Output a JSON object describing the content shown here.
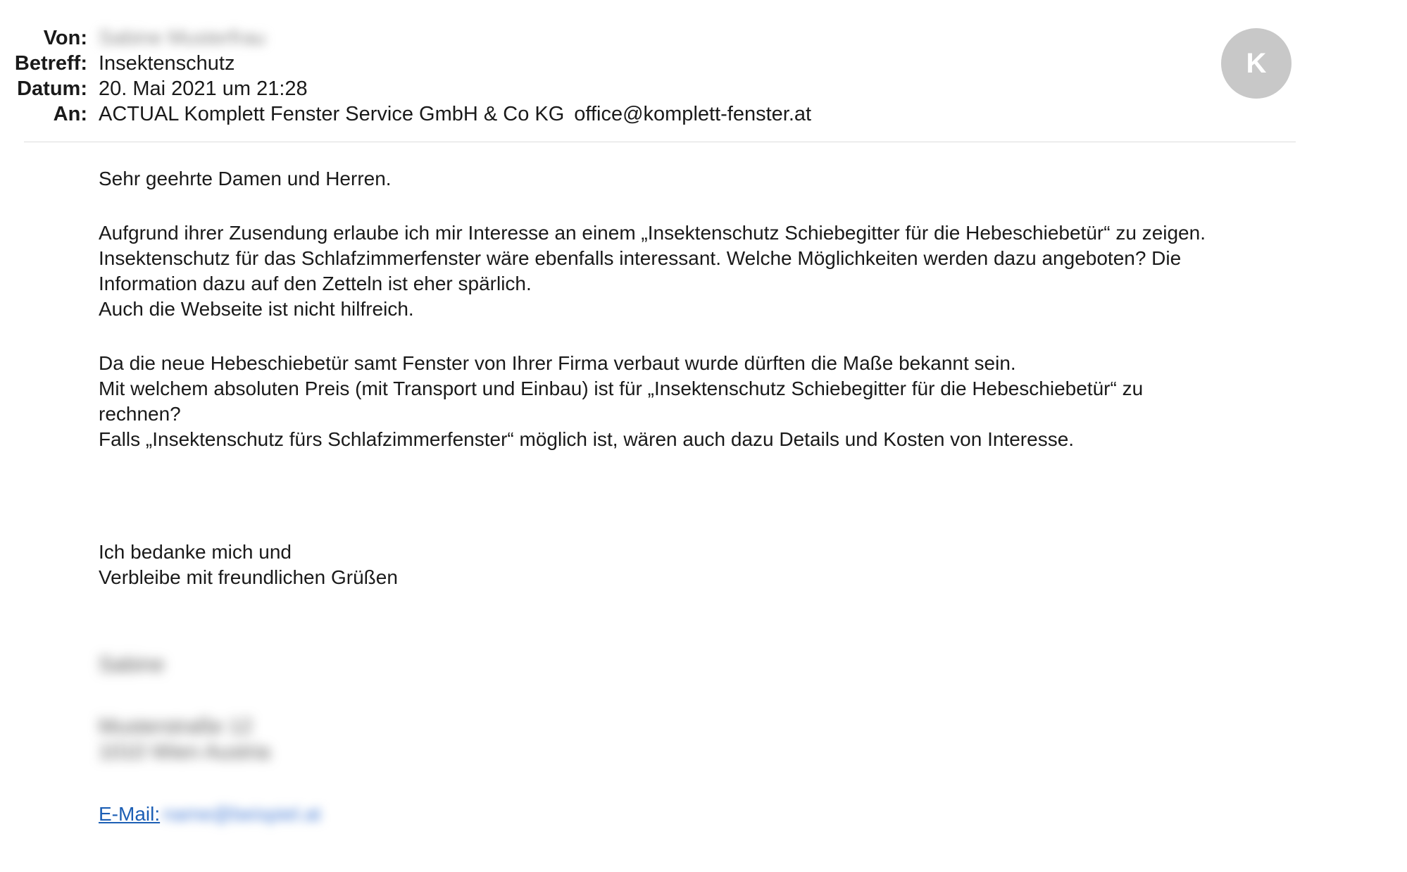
{
  "header": {
    "from_label": "Von:",
    "from_value": "Sabine Musterfrau",
    "subject_label": "Betreff:",
    "subject_value": "Insektenschutz",
    "date_label": "Datum:",
    "date_value": "20. Mai 2021 um 21:28",
    "to_label": "An:",
    "to_name": "ACTUAL Komplett Fenster Service GmbH & Co KG",
    "to_email": "office@komplett-fenster.at"
  },
  "avatar": {
    "initial": "K",
    "color": "#c8c8c8"
  },
  "body": {
    "greeting": "Sehr geehrte Damen und Herren.",
    "p1_l1": "Aufgrund ihrer Zusendung erlaube ich mir Interesse an einem „Insektenschutz Schiebegitter für die Hebeschiebetür“ zu zeigen.",
    "p1_l2": "Insektenschutz für das Schlafzimmerfenster wäre ebenfalls interessant. Welche Möglichkeiten werden dazu angeboten? Die",
    "p1_l3": "Information dazu auf den Zetteln ist eher spärlich.",
    "p1_l4": "Auch die Webseite ist nicht hilfreich.",
    "p2_l1": "Da die neue Hebeschiebetür samt Fenster von Ihrer Firma verbaut wurde dürften die Maße bekannt sein.",
    "p2_l2": "Mit welchem absoluten Preis (mit Transport und Einbau) ist für „Insektenschutz Schiebegitter für die Hebeschiebetür“ zu",
    "p2_l3": "rechnen?",
    "p2_l4": "Falls „Insektenschutz fürs Schlafzimmerfenster“ möglich ist, wären auch dazu Details und Kosten von Interesse.",
    "closing_l1": "Ich bedanke mich und",
    "closing_l2": "Verbleibe mit freundlichen Grüßen"
  },
  "signature": {
    "name": "Sabine",
    "line1": "Musterstraße 12",
    "line2": "1010 Wien Austria",
    "email_label": "E-Mail:",
    "email_value": "name@beispiel.at"
  }
}
